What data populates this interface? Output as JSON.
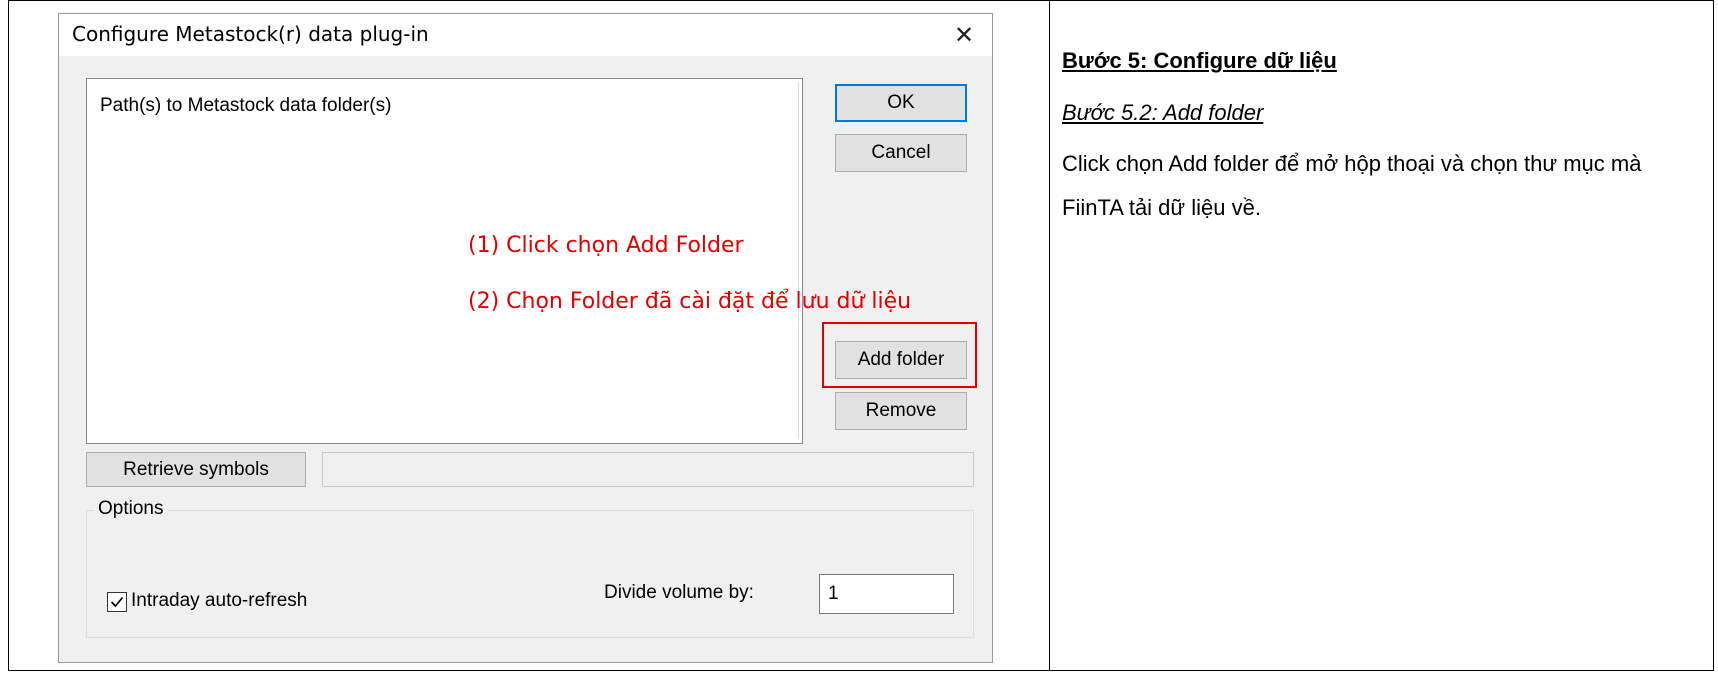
{
  "dialog": {
    "title": "Configure Metastock(r) data plug-in",
    "close_glyph": "✕",
    "list_header": "Path(s) to Metastock data folder(s)",
    "buttons": {
      "ok": "OK",
      "cancel": "Cancel",
      "add_folder": "Add folder",
      "remove": "Remove",
      "retrieve": "Retrieve symbols"
    },
    "options": {
      "group_label": "Options",
      "intraday_label": "Intraday auto-refresh",
      "intraday_checked": true,
      "divide_label": "Divide volume by:",
      "divide_value": "1"
    }
  },
  "annotations": {
    "step1": "(1) Click chọn Add Folder",
    "step2": "(2) Chọn Folder đã cài đặt để lưu dữ liệu",
    "color": "#e00000"
  },
  "instructions": {
    "title": "Bước 5: Configure dữ liệu",
    "subtitle": "Bước 5.2: Add folder",
    "description": "Click chọn Add folder để mở hộp thoại và chọn thư mục mà FiinTA tải dữ liệu về."
  }
}
